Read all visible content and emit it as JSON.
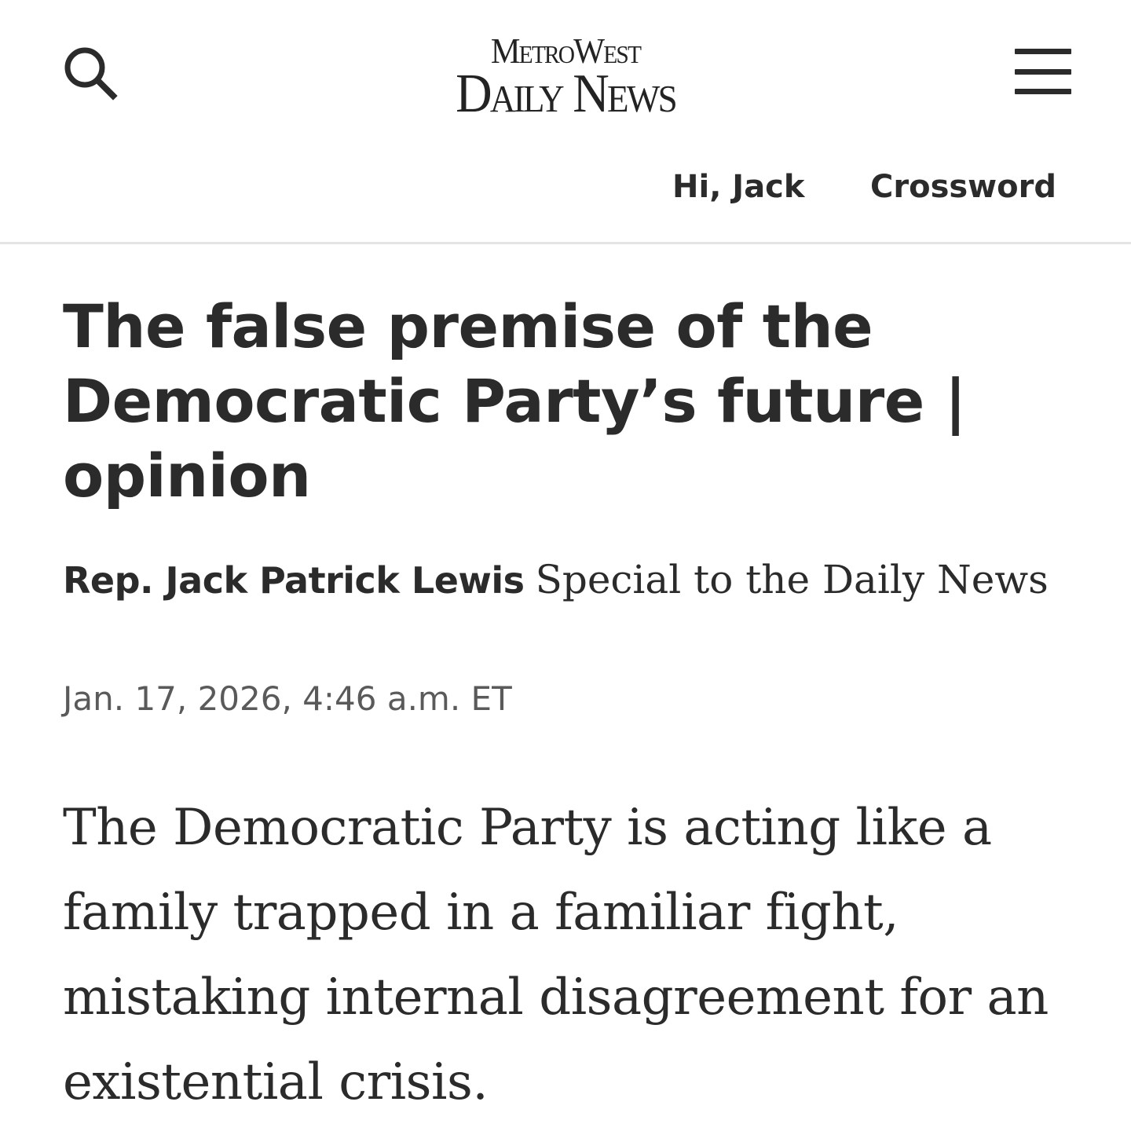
{
  "header": {
    "search_icon": "search-icon",
    "logo_line1": "MetroWest",
    "logo_line2": "Daily News",
    "menu_icon": "hamburger-menu-icon",
    "greeting": "Hi, Jack",
    "crossword_label": "Crossword"
  },
  "article": {
    "headline": "The false premise of the Democratic Party’s future | opinion",
    "author": "Rep. Jack Patrick Lewis",
    "affiliation": "Special to the Daily News",
    "timestamp": "Jan. 17, 2026, 4:46 a.m. ET",
    "lede": "The Democratic Party is acting like a family trapped in a familiar fight, mistaking internal disagreement for an existential crisis."
  }
}
